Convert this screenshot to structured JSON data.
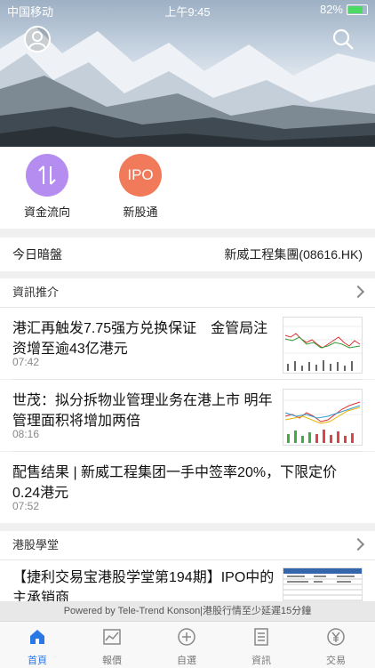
{
  "status_bar": {
    "carrier": "中国移动",
    "time": "上午9:45",
    "battery": "82%"
  },
  "quick_actions": [
    {
      "label": "資金流向",
      "icon_text": "",
      "color": "#b58cf0"
    },
    {
      "label": "新股通",
      "icon_text": "IPO",
      "color": "#f07a5a"
    }
  ],
  "dark_market": {
    "label": "今日暗盤",
    "value": "新威工程集團(08616.HK)"
  },
  "news_section": {
    "title": "資訊推介",
    "items": [
      {
        "title": "港汇再触发7.75强方兑换保证　金管局注资增至逾43亿港元",
        "time": "07:42"
      },
      {
        "title": "世茂：拟分拆物业管理业务在港上市 明年管理面积将增加两倍",
        "time": "08:16"
      },
      {
        "title": "配售结果 | 新威工程集团一手中签率20%，下限定价0.24港元",
        "time": "07:52"
      }
    ]
  },
  "school_section": {
    "title": "港股學堂",
    "items": [
      {
        "title": "【捷利交易宝港股学堂第194期】IPO中的主承销商"
      }
    ]
  },
  "footer_note": "Powered by Tele-Trend Konson|港股行情至少延遲15分鐘",
  "tabs": [
    {
      "label": "首頁",
      "icon": "home-icon"
    },
    {
      "label": "報價",
      "icon": "chart-icon"
    },
    {
      "label": "自選",
      "icon": "plus-circle-icon"
    },
    {
      "label": "資訊",
      "icon": "document-icon"
    },
    {
      "label": "交易",
      "icon": "yen-icon"
    }
  ],
  "colors": {
    "accent": "#2b78e4"
  }
}
